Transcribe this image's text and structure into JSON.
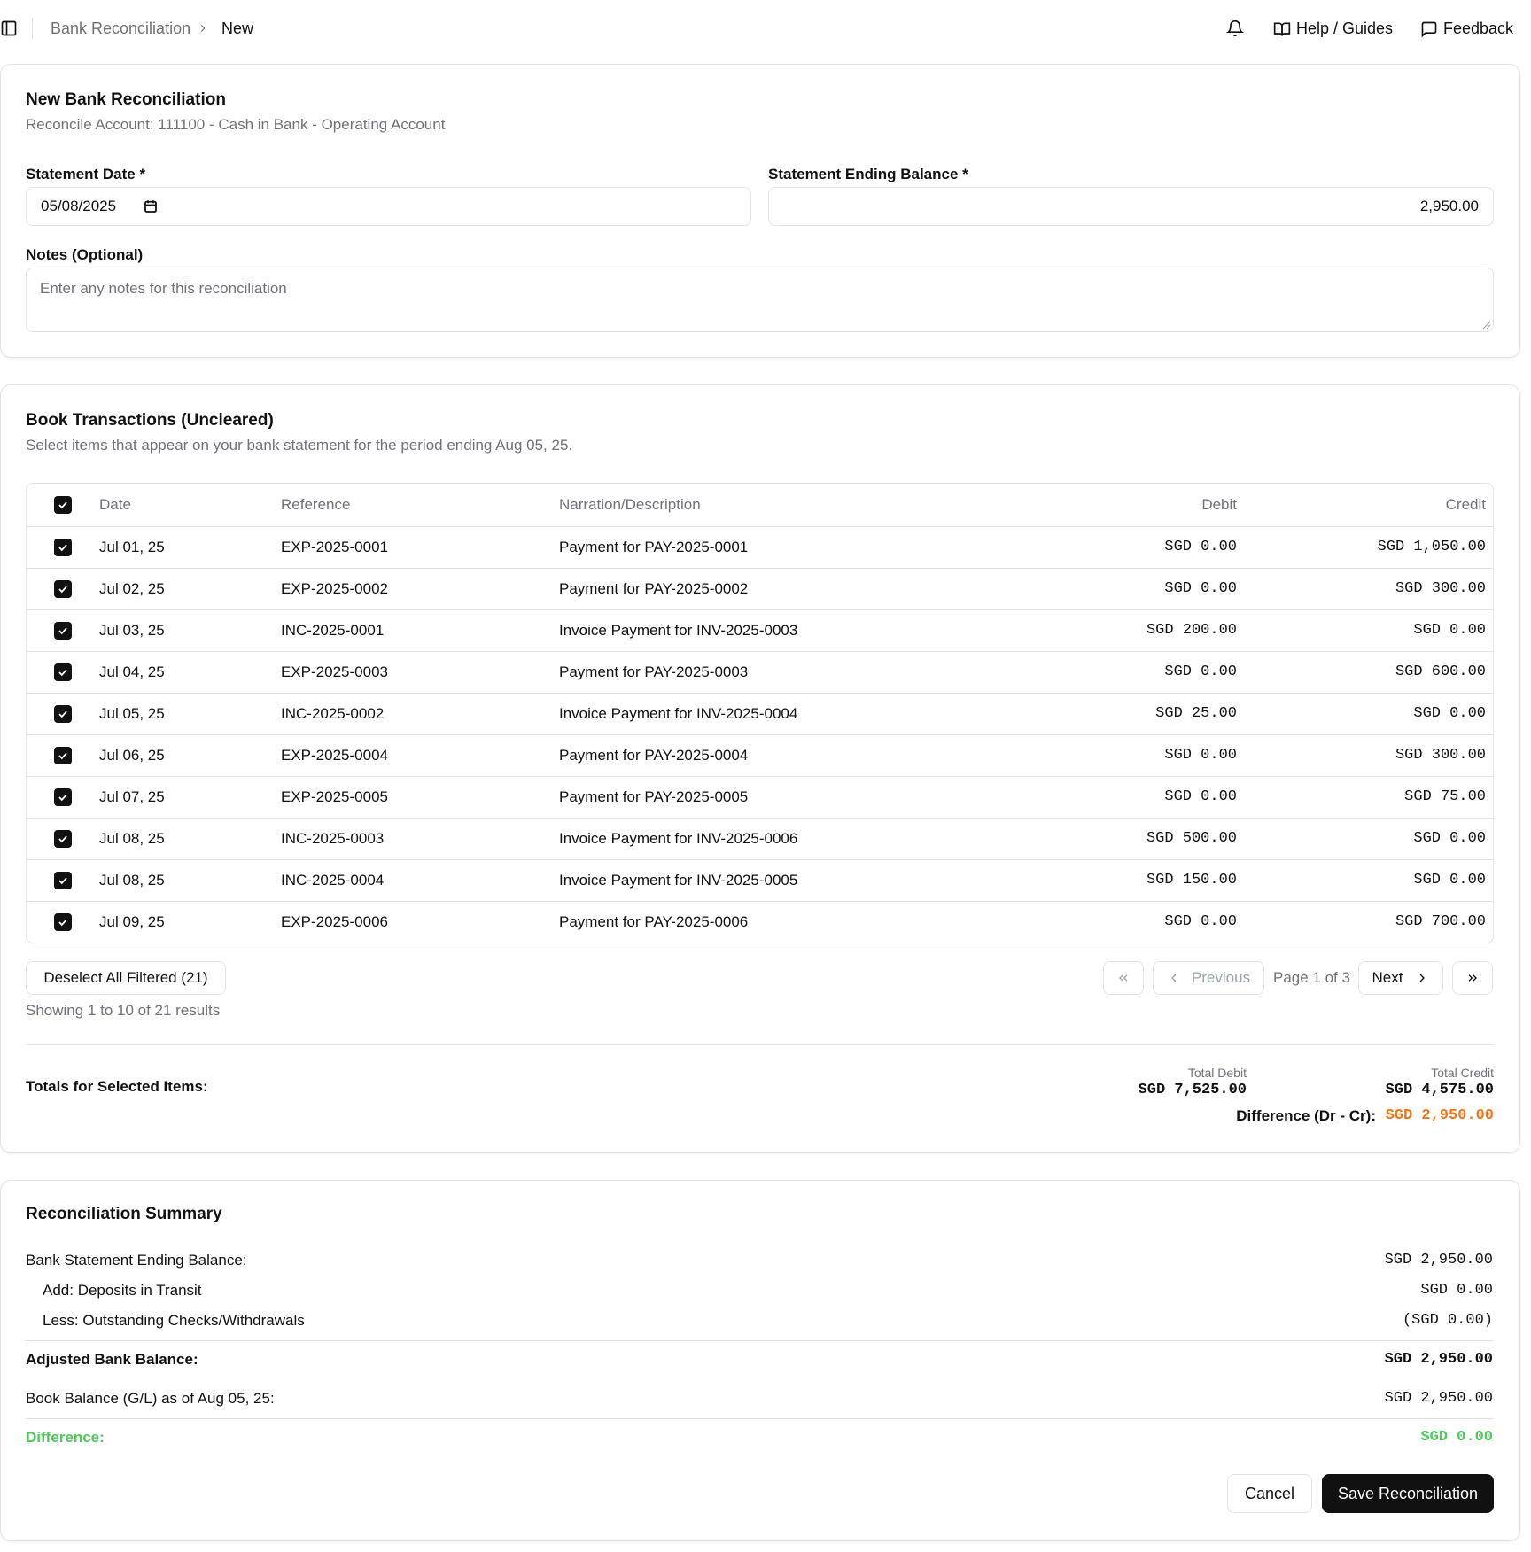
{
  "breadcrumb": {
    "parent": "Bank Reconciliation",
    "current": "New"
  },
  "header": {
    "help_label": "Help / Guides",
    "feedback_label": "Feedback"
  },
  "form": {
    "title": "New Bank Reconciliation",
    "subtitle": "Reconcile Account: 111100 - Cash in Bank - Operating Account",
    "statement_date_label": "Statement Date *",
    "statement_date_value": "05/08/2025",
    "ending_balance_label": "Statement Ending Balance *",
    "ending_balance_value": "2,950.00",
    "notes_label": "Notes (Optional)",
    "notes_placeholder": "Enter any notes for this reconciliation"
  },
  "transactions": {
    "title": "Book Transactions (Uncleared)",
    "subtitle": "Select items that appear on your bank statement for the period ending Aug 05, 25.",
    "columns": {
      "date": "Date",
      "reference": "Reference",
      "narration": "Narration/Description",
      "debit": "Debit",
      "credit": "Credit"
    },
    "rows": [
      {
        "date": "Jul 01, 25",
        "reference": "EXP-2025-0001",
        "narration": "Payment for PAY-2025-0001",
        "debit": "SGD 0.00",
        "credit": "SGD 1,050.00",
        "checked": true
      },
      {
        "date": "Jul 02, 25",
        "reference": "EXP-2025-0002",
        "narration": "Payment for PAY-2025-0002",
        "debit": "SGD 0.00",
        "credit": "SGD 300.00",
        "checked": true
      },
      {
        "date": "Jul 03, 25",
        "reference": "INC-2025-0001",
        "narration": "Invoice Payment for INV-2025-0003",
        "debit": "SGD 200.00",
        "credit": "SGD 0.00",
        "checked": true
      },
      {
        "date": "Jul 04, 25",
        "reference": "EXP-2025-0003",
        "narration": "Payment for PAY-2025-0003",
        "debit": "SGD 0.00",
        "credit": "SGD 600.00",
        "checked": true
      },
      {
        "date": "Jul 05, 25",
        "reference": "INC-2025-0002",
        "narration": "Invoice Payment for INV-2025-0004",
        "debit": "SGD 25.00",
        "credit": "SGD 0.00",
        "checked": true
      },
      {
        "date": "Jul 06, 25",
        "reference": "EXP-2025-0004",
        "narration": "Payment for PAY-2025-0004",
        "debit": "SGD 0.00",
        "credit": "SGD 300.00",
        "checked": true
      },
      {
        "date": "Jul 07, 25",
        "reference": "EXP-2025-0005",
        "narration": "Payment for PAY-2025-0005",
        "debit": "SGD 0.00",
        "credit": "SGD 75.00",
        "checked": true
      },
      {
        "date": "Jul 08, 25",
        "reference": "INC-2025-0003",
        "narration": "Invoice Payment for INV-2025-0006",
        "debit": "SGD 500.00",
        "credit": "SGD 0.00",
        "checked": true
      },
      {
        "date": "Jul 08, 25",
        "reference": "INC-2025-0004",
        "narration": "Invoice Payment for INV-2025-0005",
        "debit": "SGD 150.00",
        "credit": "SGD 0.00",
        "checked": true
      },
      {
        "date": "Jul 09, 25",
        "reference": "EXP-2025-0006",
        "narration": "Payment for PAY-2025-0006",
        "debit": "SGD 0.00",
        "credit": "SGD 700.00",
        "checked": true
      }
    ],
    "deselect_label": "Deselect All Filtered (21)",
    "showing_text": "Showing 1 to 10 of 21 results",
    "pagination": {
      "previous_label": "Previous",
      "page_text": "Page 1 of 3",
      "next_label": "Next"
    },
    "totals": {
      "label": "Totals for Selected Items:",
      "total_debit_label": "Total Debit",
      "total_debit_value": "SGD 7,525.00",
      "total_credit_label": "Total Credit",
      "total_credit_value": "SGD 4,575.00",
      "difference_label": "Difference (Dr - Cr):",
      "difference_value": "SGD 2,950.00"
    }
  },
  "summary": {
    "title": "Reconciliation Summary",
    "rows": [
      {
        "label": "Bank Statement Ending Balance:",
        "value": "SGD 2,950.00"
      },
      {
        "label": "Add: Deposits in Transit",
        "value": "SGD 0.00"
      },
      {
        "label": "Less: Outstanding Checks/Withdrawals",
        "value": "(SGD 0.00)"
      },
      {
        "label": "Adjusted Bank Balance:",
        "value": "SGD 2,950.00"
      },
      {
        "label": "Book Balance (G/L) as of Aug 05, 25:",
        "value": "SGD 2,950.00"
      },
      {
        "label": "Difference:",
        "value": "SGD 0.00"
      }
    ],
    "cancel_label": "Cancel",
    "save_label": "Save Reconciliation"
  },
  "colors": {
    "accent": "#111111",
    "difference_warning": "#f97316",
    "difference_ok": "#4ec95b",
    "border": "#e4e4e7",
    "muted": "#71717a"
  },
  "icons": [
    "sidebar-toggle-icon",
    "chevron-right-icon",
    "bell-icon",
    "book-open-icon",
    "message-square-icon",
    "calendar-icon",
    "check-icon",
    "chevrons-left-icon",
    "chevron-left-icon",
    "chevrons-right-icon"
  ]
}
